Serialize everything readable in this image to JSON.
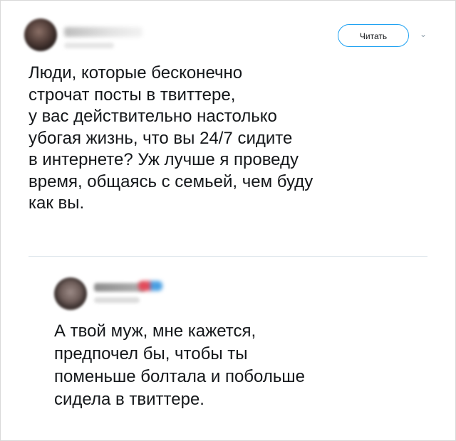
{
  "tweet": {
    "follow_label": "Читать",
    "text": "Люди, которые бесконечно\nстрочат посты в твиттере,\nу вас действительно настолько\nубогая жизнь, что вы 24/7 сидите\nв интернете? Уж лучше я проведу\nвремя, общаясь с семьей, чем буду\nкак вы."
  },
  "reply": {
    "text": "А твой муж, мне кажется,\nпредпочел бы, чтобы ты\nпоменьше болтала и побольше\nсидела в твиттере."
  },
  "icons": {
    "menu": "chevron-down-icon",
    "avatar": "avatar"
  },
  "colors": {
    "accent": "#1da1f2",
    "text": "#14171a",
    "divider": "#e1e8ed"
  }
}
